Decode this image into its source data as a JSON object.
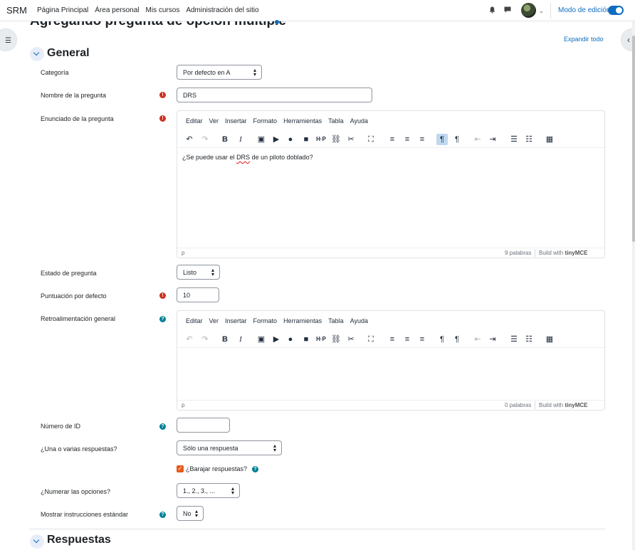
{
  "nav": {
    "brand": "SRM",
    "links": [
      "Página Principal",
      "Área personal",
      "Mis cursos",
      "Administración del sitio"
    ],
    "edit_mode_label": "Modo de edición",
    "edit_mode_on": true
  },
  "page": {
    "heading": "Agregando pregunta de opción múltiple",
    "expand_all": "Expandir todo"
  },
  "sections": {
    "general": "General",
    "answers": "Respuestas"
  },
  "form": {
    "category": {
      "label": "Categoría",
      "value": "Por defecto en A"
    },
    "question_name": {
      "label": "Nombre de la pregunta",
      "value": "DRS"
    },
    "question_text": {
      "label": "Enunciado de la pregunta",
      "content_prefix": "¿Se puede usar el ",
      "content_misspelled": "DRS",
      "content_suffix": " de un piloto doblado?",
      "path": "p",
      "word_count": "9 palabras"
    },
    "status": {
      "label": "Estado de pregunta",
      "value": "Listo"
    },
    "default_mark": {
      "label": "Puntuación por defecto",
      "value": "10"
    },
    "general_feedback": {
      "label": "Retroalimentación general",
      "path": "p",
      "word_count": "0 palabras"
    },
    "id_number": {
      "label": "Número de ID",
      "value": ""
    },
    "single": {
      "label": "¿Una o varias respuestas?",
      "value": "Sólo una respuesta"
    },
    "shuffle": {
      "label": "¿Barajar respuestas?",
      "checked": true
    },
    "numbering": {
      "label": "¿Numerar las opciones?",
      "value": "1., 2., 3., ..."
    },
    "show_instructions": {
      "label": "Mostrar instrucciones estándar",
      "value": "No"
    }
  },
  "editor": {
    "menu": [
      "Editar",
      "Ver",
      "Insertar",
      "Formato",
      "Herramientas",
      "Tabla",
      "Ayuda"
    ],
    "built_with": "Build with",
    "brand": "tinyMCE"
  },
  "colors": {
    "accent": "#0f6cbf",
    "required": "#ca3120",
    "help": "#008196",
    "checkbox": "#e8591a"
  }
}
